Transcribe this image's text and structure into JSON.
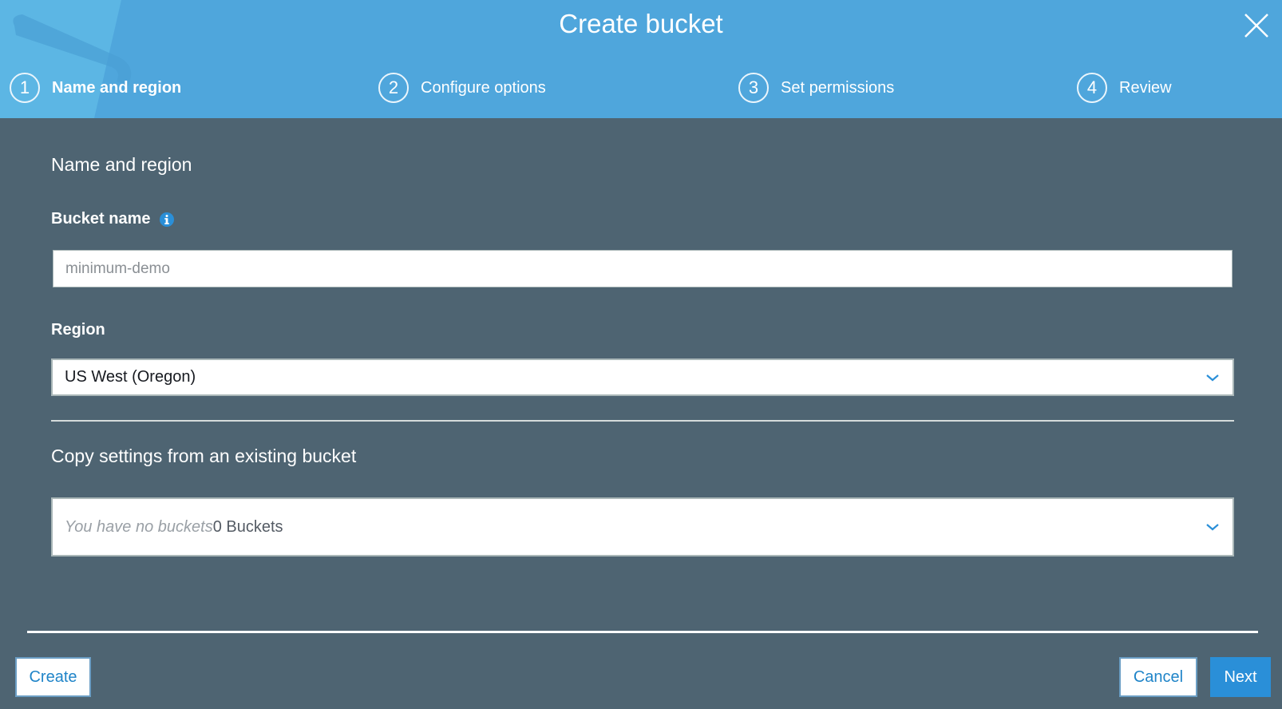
{
  "dialog": {
    "title": "Create bucket",
    "close_icon": "close-icon"
  },
  "steps": [
    {
      "number": "1",
      "label": "Name and region",
      "active": true
    },
    {
      "number": "2",
      "label": "Configure options",
      "active": false
    },
    {
      "number": "3",
      "label": "Set permissions",
      "active": false
    },
    {
      "number": "4",
      "label": "Review",
      "active": false
    }
  ],
  "form": {
    "section_title": "Name and region",
    "bucket_name_label": "Bucket name",
    "bucket_name_info_icon": "info-icon",
    "bucket_name_value": "",
    "bucket_name_placeholder": "minimum-demo",
    "region_label": "Region",
    "region_value": "US West (Oregon)",
    "copy_title": "Copy settings from an existing bucket",
    "copy_placeholder": "You have no buckets",
    "copy_count": "0 Buckets"
  },
  "footer": {
    "create_label": "Create",
    "cancel_label": "Cancel",
    "next_label": "Next"
  },
  "colors": {
    "header_bg": "#4fa6dc",
    "body_bg": "#4e6472",
    "accent": "#2a8fd8"
  }
}
